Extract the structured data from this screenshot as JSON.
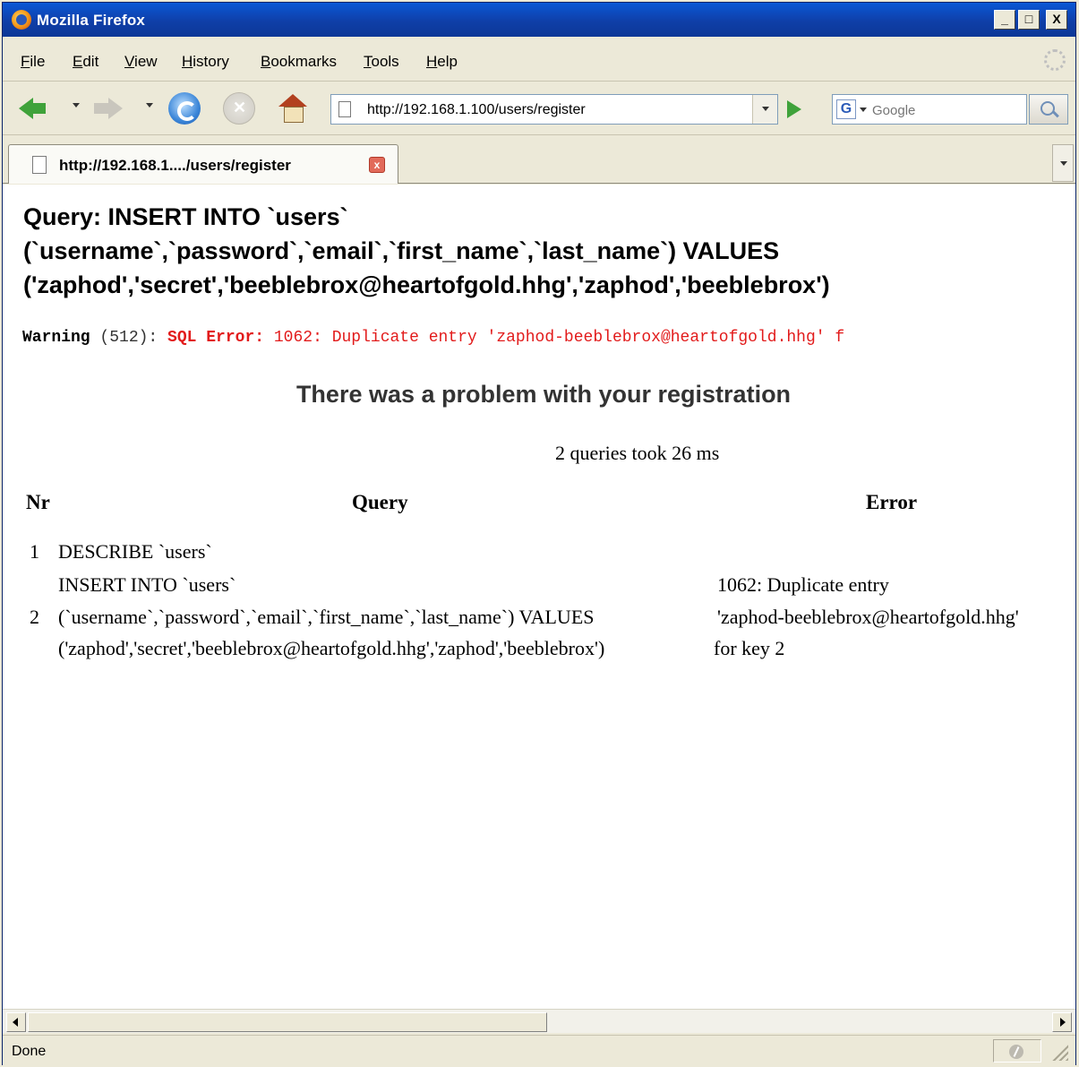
{
  "window": {
    "title": "Mozilla Firefox",
    "controls": {
      "minimize": "_",
      "maximize": "□",
      "close": "X"
    }
  },
  "menu": [
    "File",
    "Edit",
    "View",
    "History",
    "Bookmarks",
    "Tools",
    "Help"
  ],
  "navigation": {
    "url": "http://192.168.1.100/users/register",
    "search_engine_letter": "G",
    "search_placeholder": "Google"
  },
  "tab": {
    "title": "http://192.168.1..../users/register",
    "close_glyph": "x"
  },
  "content": {
    "query_heading_lines": [
      "Query: INSERT INTO `users`",
      "(`username`,`password`,`email`,`first_name`,`last_name`) VALUES",
      "('zaphod','secret','beeblebrox@heartofgold.hhg','zaphod','beeblebrox')"
    ],
    "warning": {
      "label": "Warning",
      "code": " (512): ",
      "error_label": "SQL Error:",
      "message": " 1062: Duplicate entry 'zaphod-beeblebrox@heartofgold.hhg' f"
    },
    "problem_message": "There was a problem with your registration",
    "queries_summary": "2 queries took 26 ms",
    "table": {
      "headers": {
        "nr": "Nr",
        "query": "Query",
        "error": "Error"
      },
      "rows": [
        {
          "nr": "1",
          "query_lines": [
            "DESCRIBE `users`"
          ],
          "error_lines": []
        },
        {
          "nr": "2",
          "query_lines": [
            "INSERT INTO `users`",
            "(`username`,`password`,`email`,`first_name`,`last_name`) VALUES",
            "('zaphod','secret','beeblebrox@heartofgold.hhg','zaphod','beeblebrox')"
          ],
          "error_lines": [
            "1062: Duplicate entry",
            "'zaphod-beeblebrox@heartofgold.hhg'",
            "for key 2"
          ]
        }
      ]
    }
  },
  "status": {
    "text": "Done"
  }
}
